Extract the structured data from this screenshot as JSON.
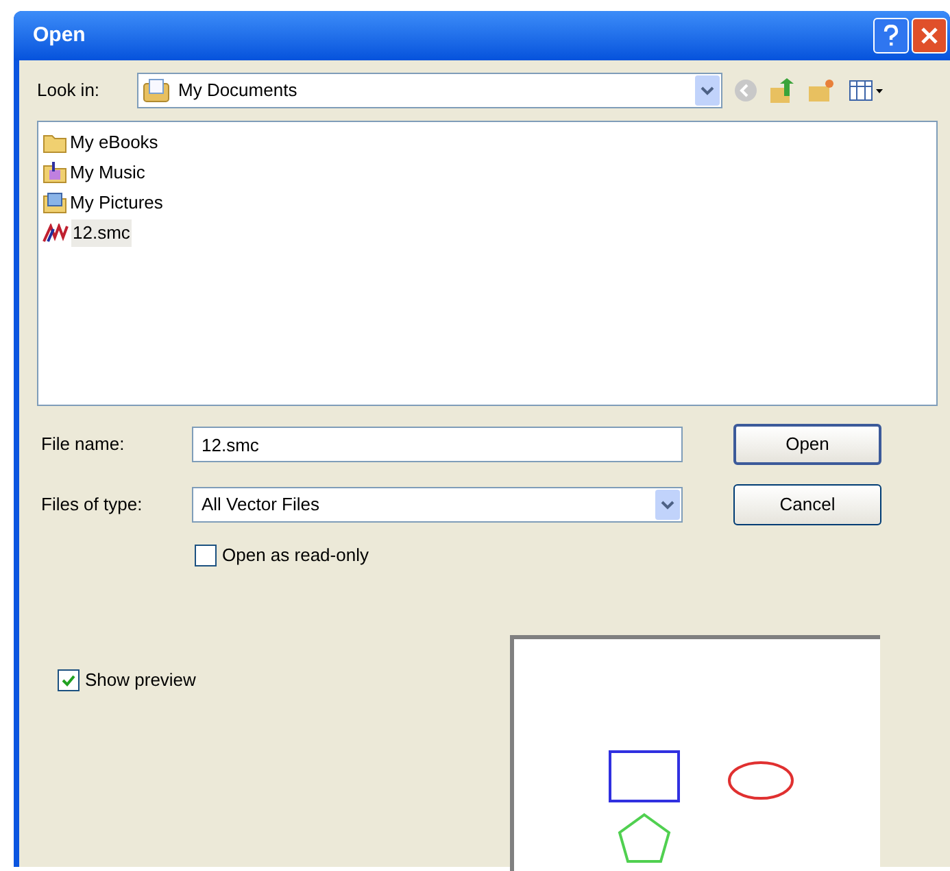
{
  "window": {
    "title": "Open"
  },
  "look_in": {
    "label": "Look in:",
    "value": "My Documents"
  },
  "files": [
    {
      "name": "My eBooks",
      "kind": "folder",
      "selected": false
    },
    {
      "name": "My Music",
      "kind": "music",
      "selected": false
    },
    {
      "name": "My Pictures",
      "kind": "pictures",
      "selected": false
    },
    {
      "name": "12.smc",
      "kind": "smc",
      "selected": true
    }
  ],
  "file_name": {
    "label": "File name:",
    "value": "12.smc"
  },
  "file_type": {
    "label": "Files of type:",
    "value": "All Vector Files"
  },
  "buttons": [
    "Open",
    "Cancel"
  ],
  "read_only": {
    "label": "Open as read-only",
    "checked": false
  },
  "show_preview": {
    "label": "Show preview",
    "checked": true
  }
}
